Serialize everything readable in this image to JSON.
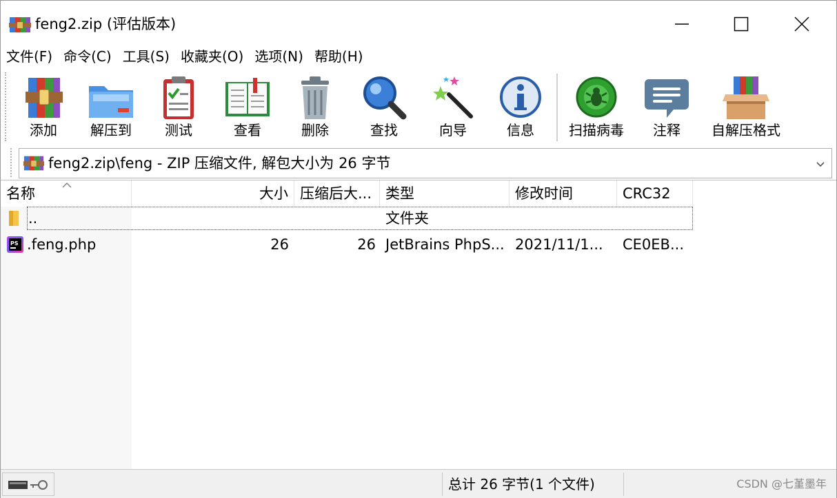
{
  "window": {
    "title": "feng2.zip (评估版本)"
  },
  "menu": [
    "文件(F)",
    "命令(C)",
    "工具(S)",
    "收藏夹(O)",
    "选项(N)",
    "帮助(H)"
  ],
  "toolbar": {
    "buttons": [
      {
        "label": "添加",
        "icon": "add-archive-icon"
      },
      {
        "label": "解压到",
        "icon": "extract-folder-icon"
      },
      {
        "label": "测试",
        "icon": "test-clipboard-icon"
      },
      {
        "label": "查看",
        "icon": "view-book-icon"
      },
      {
        "label": "删除",
        "icon": "trash-icon"
      },
      {
        "label": "查找",
        "icon": "magnifier-icon"
      },
      {
        "label": "向导",
        "icon": "wizard-wand-icon"
      },
      {
        "label": "信息",
        "icon": "info-icon"
      },
      {
        "label": "扫描病毒",
        "icon": "virus-scan-icon"
      },
      {
        "label": "注释",
        "icon": "comment-icon"
      },
      {
        "label": "自解压格式",
        "icon": "sfx-box-icon"
      }
    ]
  },
  "address": {
    "path": "feng2.zip\\feng - ZIP 压缩文件, 解包大小为 26 字节"
  },
  "columns": {
    "name": "名称",
    "size": "大小",
    "packed": "压缩后大...",
    "type": "类型",
    "modified": "修改时间",
    "crc": "CRC32"
  },
  "files": [
    {
      "name": "..",
      "size": "",
      "packed": "",
      "type": "文件夹",
      "modified": "",
      "crc": "",
      "icon": "folder-icon"
    },
    {
      "name": ".feng.php",
      "size": "26",
      "packed": "26",
      "type": "JetBrains PhpS...",
      "modified": "2021/11/1...",
      "crc": "CE0EB...",
      "icon": "phpstorm-file-icon"
    }
  ],
  "status": {
    "total": "总计 26 字节(1 个文件)",
    "watermark": "CSDN @七堇墨年"
  },
  "colors": {
    "accent_blue": "#2a73c9",
    "green": "#2f9a2f",
    "red": "#d03a2a"
  }
}
